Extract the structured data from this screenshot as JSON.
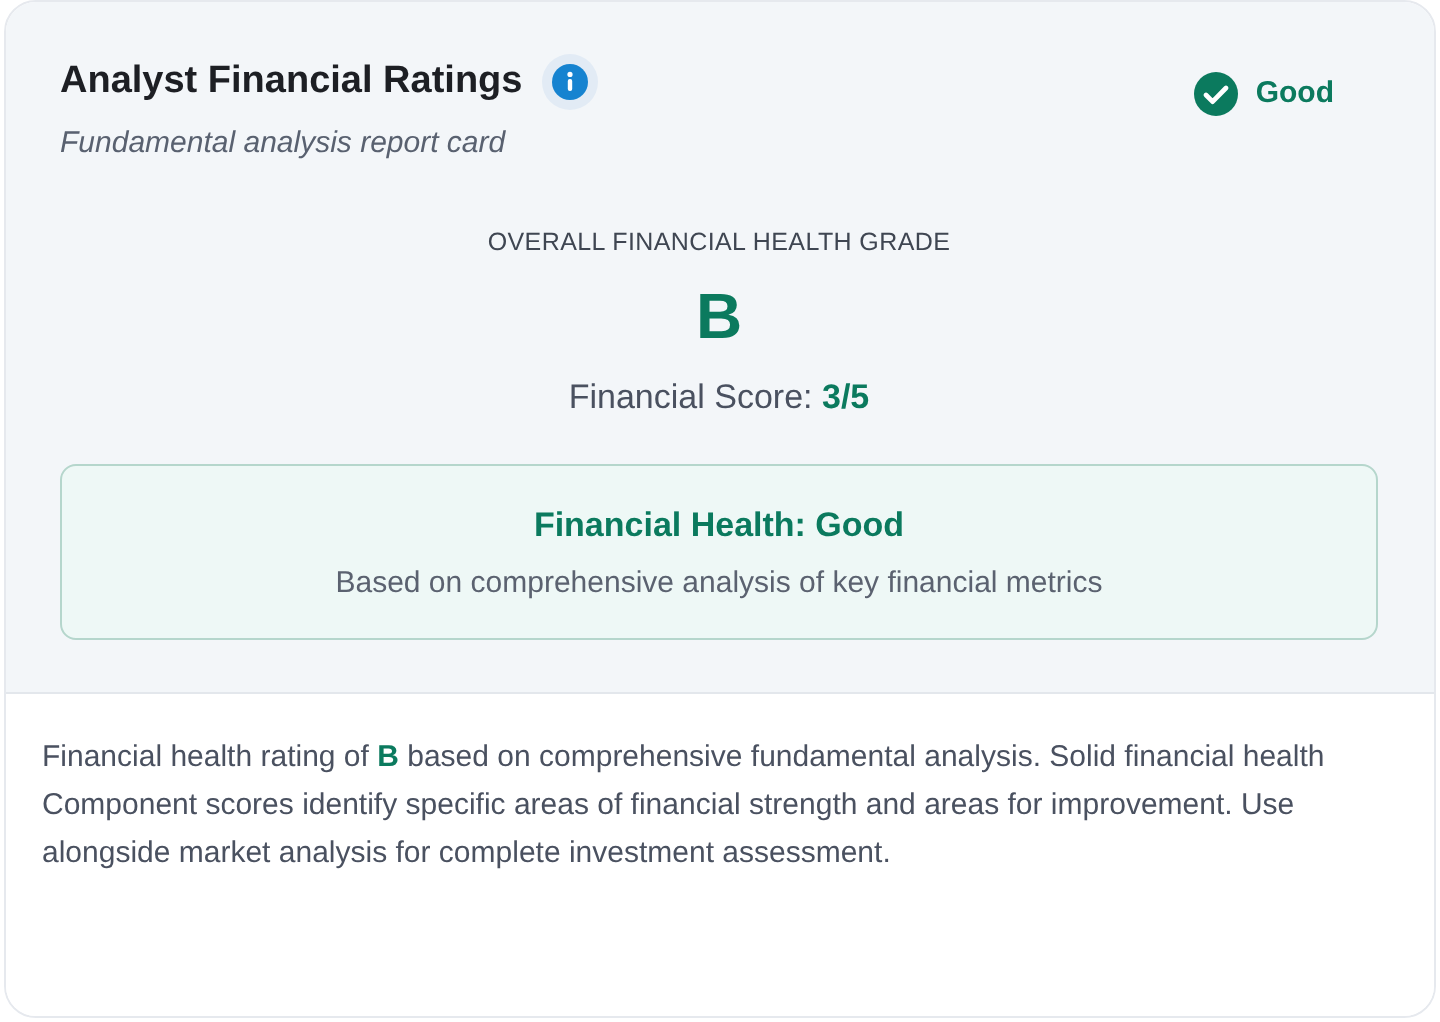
{
  "header": {
    "title": "Analyst Financial Ratings",
    "subtitle": "Fundamental analysis report card",
    "status_badge": {
      "label": "Good"
    }
  },
  "grade_section": {
    "caption": "OVERALL FINANCIAL HEALTH GRADE",
    "grade": "B",
    "score": "Financial Score: **3/5**"
  },
  "health_box": {
    "title": "Financial Health: Good",
    "description": "Based on comprehensive analysis of key financial metrics"
  },
  "summary": "Financial health rating of **B** based on comprehensive fundamental analysis. Solid financial health Component scores identify specific areas of financial strength and areas for improvement. Use alongside market analysis for complete investment assessment."
}
